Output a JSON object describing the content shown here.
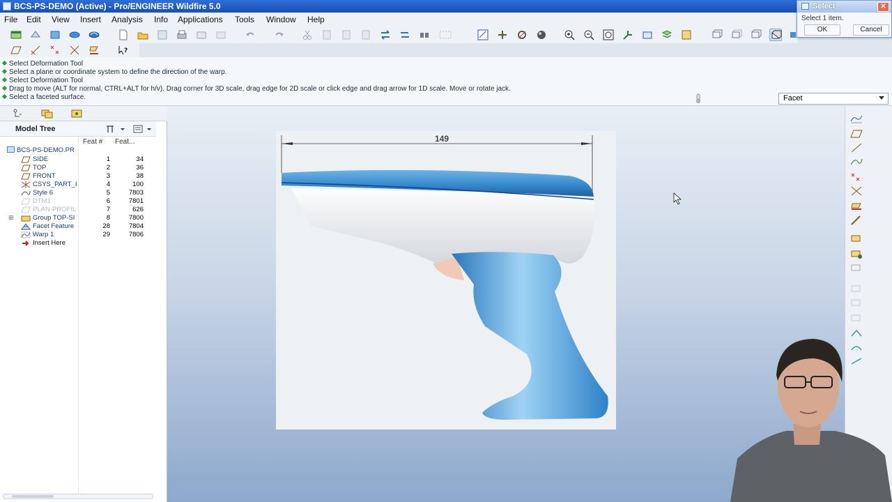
{
  "window": {
    "title": "BCS-PS-DEMO (Active) - Pro/ENGINEER Wildfire 5.0"
  },
  "menu": [
    "File",
    "Edit",
    "View",
    "Insert",
    "Analysis",
    "Info",
    "Applications",
    "Tools",
    "Window",
    "Help"
  ],
  "toolbar_icons": [
    "window-icon",
    "dims-icon",
    "annotation-icon",
    "shade-icon",
    "display-icon",
    "new-icon",
    "open-icon",
    "save-icon",
    "print-icon",
    "send-icon",
    "copy-icon",
    "undo-icon",
    "redo-icon",
    "cut-icon",
    "paste-icon",
    "paste-special-icon",
    "regen-icon",
    "regen-manager-icon",
    "find-icon",
    "select-box-icon",
    "repaint-icon",
    "spin-center-icon",
    "orient-icon",
    "appearance-icon",
    "zoom-in-icon",
    "zoom-out-icon",
    "refit-icon",
    "reorient-icon",
    "saved-views-icon",
    "layers-icon",
    "view-manager-icon",
    "wireframe-icon",
    "hidden-line-icon",
    "no-hidden-icon",
    "shading-icon",
    "enhanced-realism-icon"
  ],
  "messages": [
    "Select Deformation Tool",
    "Select a plane or coordinate system to define the direction of the warp.",
    "Select Deformation Tool",
    "Drag to move (ALT for normal, CTRL+ALT for h/v). Drag corner for 3D scale, drag edge for 2D scale or click edge and drag arrow for 1D scale. Move or rotate jack.",
    "Select a faceted surface."
  ],
  "filter": {
    "value": "Facet"
  },
  "model_tree": {
    "title": "Model Tree",
    "col_feat_num": "Feat #",
    "col_feat_id": "Feat...",
    "root": "BCS-PS-DEMO.PR",
    "rows": [
      {
        "name": "SIDE",
        "num": "1",
        "id": "34",
        "icon": "datum-plane-icon",
        "dim": false
      },
      {
        "name": "TOP",
        "num": "2",
        "id": "36",
        "icon": "datum-plane-icon",
        "dim": false
      },
      {
        "name": "FRONT",
        "num": "3",
        "id": "38",
        "icon": "datum-plane-icon",
        "dim": false
      },
      {
        "name": "CSYS_PART_I",
        "num": "4",
        "id": "100",
        "icon": "csys-icon",
        "dim": false
      },
      {
        "name": "Style 6",
        "num": "5",
        "id": "7803",
        "icon": "style-icon",
        "dim": false
      },
      {
        "name": "DTM1",
        "num": "6",
        "id": "7801",
        "icon": "datum-plane-icon",
        "dim": true
      },
      {
        "name": "PLAN-PROFIL",
        "num": "7",
        "id": "626",
        "icon": "datum-plane-icon",
        "dim": true
      },
      {
        "name": "Group TOP-SI",
        "num": "8",
        "id": "7800",
        "icon": "group-icon",
        "dim": false
      },
      {
        "name": "Facet Feature",
        "num": "28",
        "id": "7804",
        "icon": "facet-icon",
        "dim": false
      },
      {
        "name": "Warp 1",
        "num": "29",
        "id": "7806",
        "icon": "warp-icon",
        "dim": false
      },
      {
        "name": "Insert Here",
        "num": "",
        "id": "",
        "icon": "insert-arrow-icon",
        "dim": false
      }
    ]
  },
  "graphics": {
    "dimension_label": "149"
  },
  "select_dialog": {
    "title": "Select",
    "message": "Select 1 item.",
    "ok": "OK",
    "cancel": "Cancel"
  },
  "colors": {
    "accent": "#2d6fd6",
    "model_blue": "#3a8fd0",
    "model_white": "#e9ecef"
  }
}
